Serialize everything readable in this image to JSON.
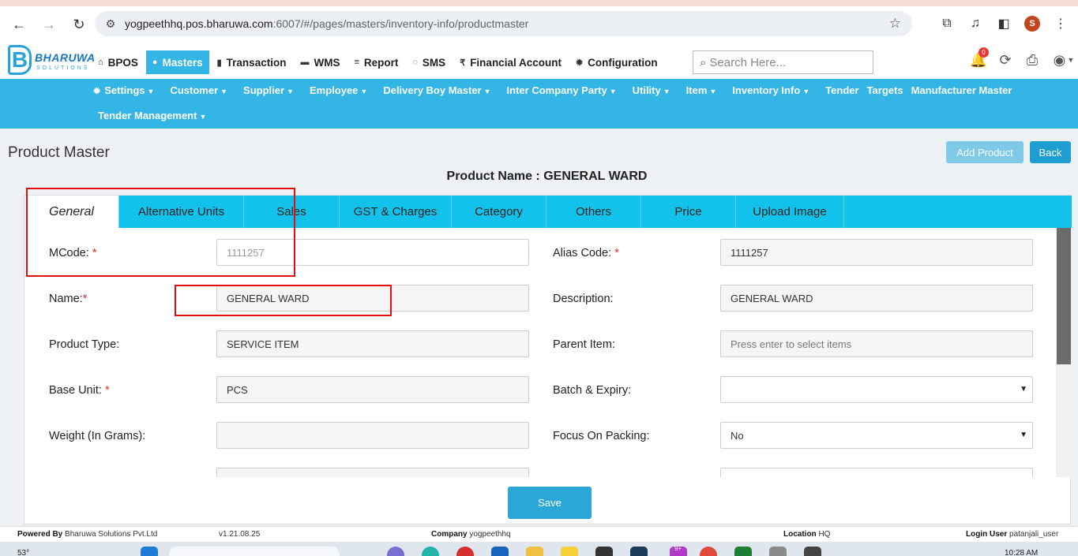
{
  "browser": {
    "url_host": "yogpeethhq.pos.bharuwa.com",
    "url_path": ":6007/#/pages/masters/inventory-info/productmaster",
    "profile_initial": "S"
  },
  "logo": {
    "letter": "B",
    "name": "BHARUWA",
    "sub": "SOLUTIONS"
  },
  "top_nav": [
    {
      "label": "BPOS",
      "icon": "home-icon",
      "glyph": "⌂"
    },
    {
      "label": "Masters",
      "icon": "user-icon",
      "glyph": "●"
    },
    {
      "label": "Transaction",
      "icon": "bar-chart-icon",
      "glyph": "▮"
    },
    {
      "label": "WMS",
      "icon": "box-icon",
      "glyph": "▬"
    },
    {
      "label": "Report",
      "icon": "list-icon",
      "glyph": "≡"
    },
    {
      "label": "SMS",
      "icon": "chat-icon",
      "glyph": "◌"
    },
    {
      "label": "Financial Account",
      "icon": "rupee-icon",
      "glyph": "₹"
    },
    {
      "label": "Configuration",
      "icon": "gear-icon",
      "glyph": "✹"
    }
  ],
  "search": {
    "placeholder": "Search Here..."
  },
  "notification_count": "0",
  "sub_nav": {
    "settings": "Settings",
    "customer": "Customer",
    "supplier": "Supplier",
    "employee": "Employee",
    "delivery_boy": "Delivery Boy Master",
    "inter_company": "Inter Company Party",
    "utility": "Utility",
    "item": "Item",
    "inventory_info": "Inventory Info",
    "tender": "Tender",
    "targets": "Targets",
    "manufacturer": "Manufacturer Master",
    "tender_management": "Tender Management"
  },
  "page": {
    "title": "Product Master",
    "add_button": "Add Product",
    "back_button": "Back",
    "product_name": "Product Name : GENERAL WARD"
  },
  "tabs": [
    "General",
    "Alternative Units",
    "Sales",
    "GST & Charges",
    "Category",
    "Others",
    "Price",
    "Upload Image"
  ],
  "form": {
    "mcode": {
      "label": "MCode:",
      "value": "1111257"
    },
    "alias_code": {
      "label": "Alias Code:",
      "value": "1111257"
    },
    "name": {
      "label": "Name:",
      "value": "GENERAL WARD"
    },
    "description": {
      "label": "Description:",
      "value": "GENERAL WARD"
    },
    "product_type": {
      "label": "Product Type:",
      "value": "SERVICE ITEM"
    },
    "parent_item": {
      "label": "Parent Item:",
      "placeholder": "Press enter to select items"
    },
    "base_unit": {
      "label": "Base Unit:",
      "value": "PCS"
    },
    "batch_expiry": {
      "label": "Batch & Expiry:",
      "value": ""
    },
    "weight": {
      "label": "Weight (In Grams):",
      "value": ""
    },
    "focus_packing": {
      "label": "Focus On Packing:",
      "value": "No"
    },
    "required_mark": "*"
  },
  "save_button": "Save",
  "footer": {
    "powered_label": "Powered By",
    "powered_value": "Bharuwa Solutions Pvt.Ltd",
    "version": "v1.21.08.25",
    "company_label": "Company",
    "company_value": "yogpeethhq",
    "location_label": "Location",
    "location_value": "HQ",
    "login_label": "Login User",
    "login_value": "patanjali_user"
  },
  "taskbar": {
    "weather": "53°",
    "time": "10:28 AM",
    "badge": "9+"
  }
}
